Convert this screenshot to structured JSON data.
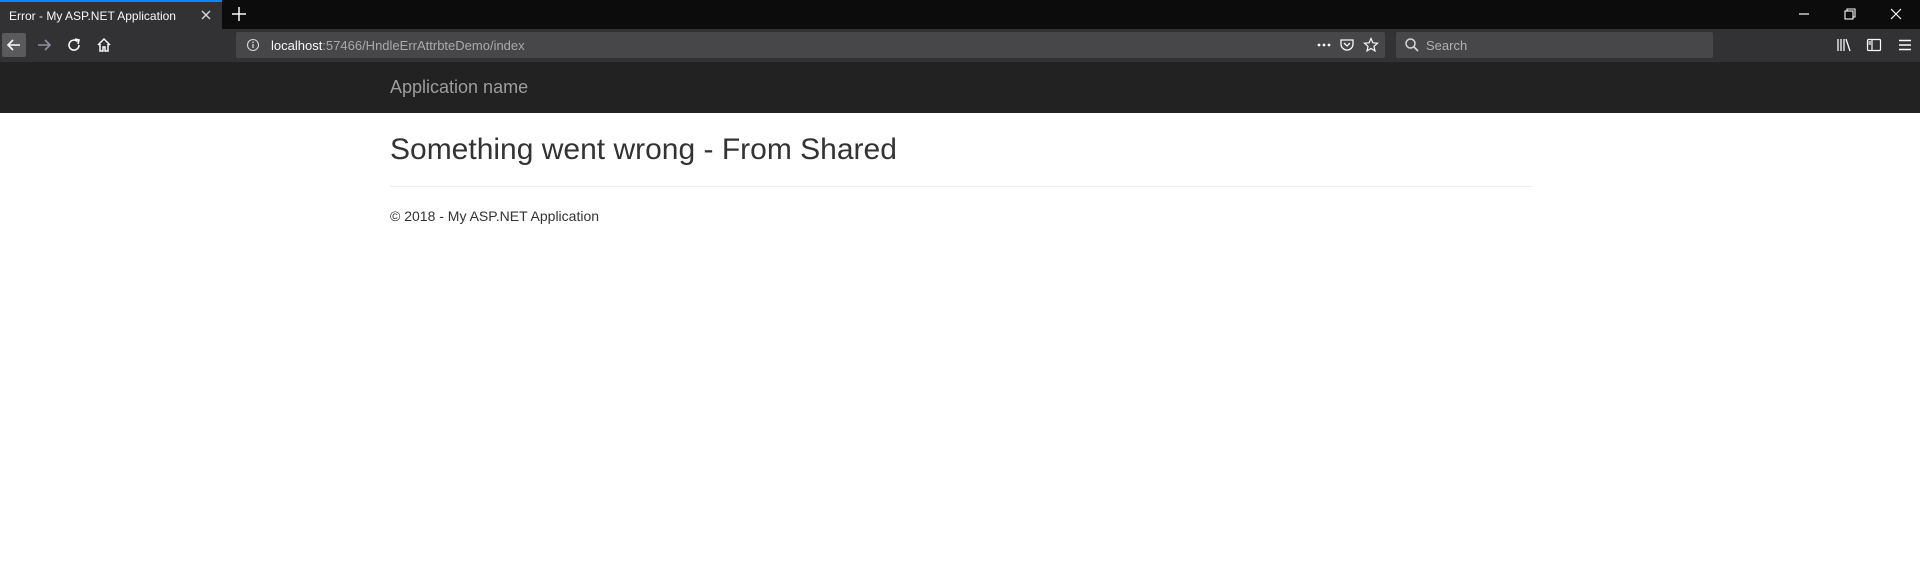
{
  "browser": {
    "tab": {
      "title": "Error - My ASP.NET Application"
    },
    "url": {
      "host": "localhost",
      "rest": ":57466/HndleErrAttrbteDemo/index"
    },
    "search": {
      "placeholder": "Search"
    },
    "icons": [
      "close-icon",
      "plus-icon",
      "minimize-icon",
      "restore-icon",
      "window-close-icon",
      "back-arrow-icon",
      "forward-arrow-icon",
      "reload-icon",
      "home-icon",
      "info-icon",
      "more-dots-icon",
      "pocket-icon",
      "star-icon",
      "search-icon",
      "library-icon",
      "sidebar-icon",
      "menu-icon"
    ],
    "colors": {
      "accent": "#0a84ff",
      "chrome_dark": "#0c0c0d",
      "toolbar": "#323234",
      "field": "#474749"
    }
  },
  "app": {
    "brand": "Application name",
    "heading": "Something went wrong - From Shared",
    "footer": "© 2018 - My ASP.NET Application",
    "colors": {
      "navbar": "#222222",
      "brand_text": "#9d9d9d",
      "text": "#333333"
    }
  }
}
